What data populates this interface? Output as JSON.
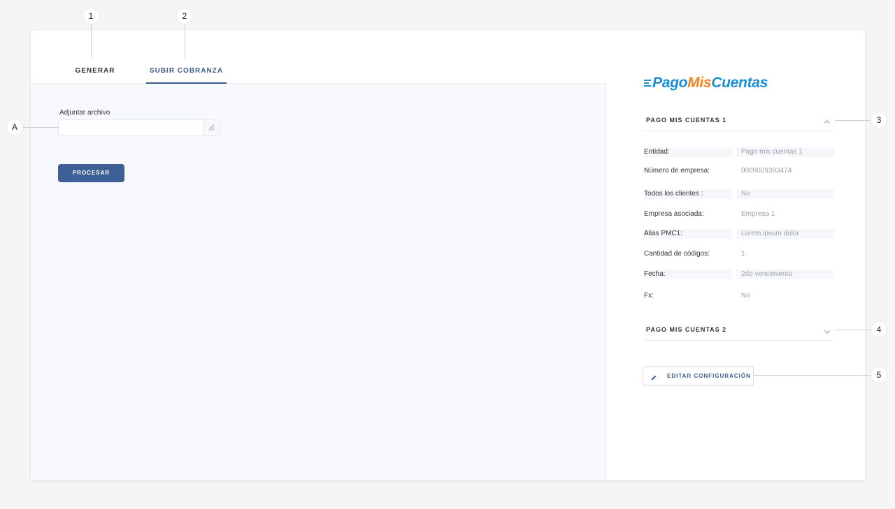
{
  "callouts": {
    "c1": "1",
    "c2": "2",
    "c3": "3",
    "c4": "4",
    "c5": "5",
    "cA": "A"
  },
  "tabs": {
    "generar": "GENERAR",
    "subir": "SUBIR COBRANZA",
    "active": "SUBIR COBRANZA"
  },
  "upload": {
    "label": "Adjuntar archivo",
    "value": "",
    "process_button": "PROCESAR"
  },
  "logo": {
    "part1": "Pago",
    "part2": "Mis",
    "part3": "Cuentas"
  },
  "config": {
    "section1": {
      "title": "PAGO MIS CUENTAS 1",
      "expanded": true,
      "fields": [
        {
          "label": "Entidad:",
          "value": "Pago mis cuentas 1"
        },
        {
          "label": "Número de empresa:",
          "value": "0009029393474"
        },
        {
          "label": "Todos los clientes :",
          "value": "No"
        },
        {
          "label": "Empresa asociada:",
          "value": "Empresa 1"
        },
        {
          "label": "Alias PMC1:",
          "value": "Lorem ipsum dolor"
        },
        {
          "label": "Cantidad de códigos:",
          "value": "1"
        },
        {
          "label": "Fecha:",
          "value": "2do vencimiento"
        },
        {
          "label": "Fx:",
          "value": "No"
        }
      ]
    },
    "section2": {
      "title": "PAGO MIS CUENTAS 2",
      "expanded": false
    },
    "edit_button": "EDITAR CONFIGURACIÓN"
  },
  "colors": {
    "primary": "#3d6096",
    "brand_blue": "#1a8fd6",
    "brand_orange": "#f58220",
    "value_text": "#9aa1ab"
  },
  "icons": {
    "file_input": "paperclip-icon",
    "section1_toggle": "chevron-up-icon",
    "section2_toggle": "chevron-down-icon",
    "edit_button": "pencil-icon"
  }
}
